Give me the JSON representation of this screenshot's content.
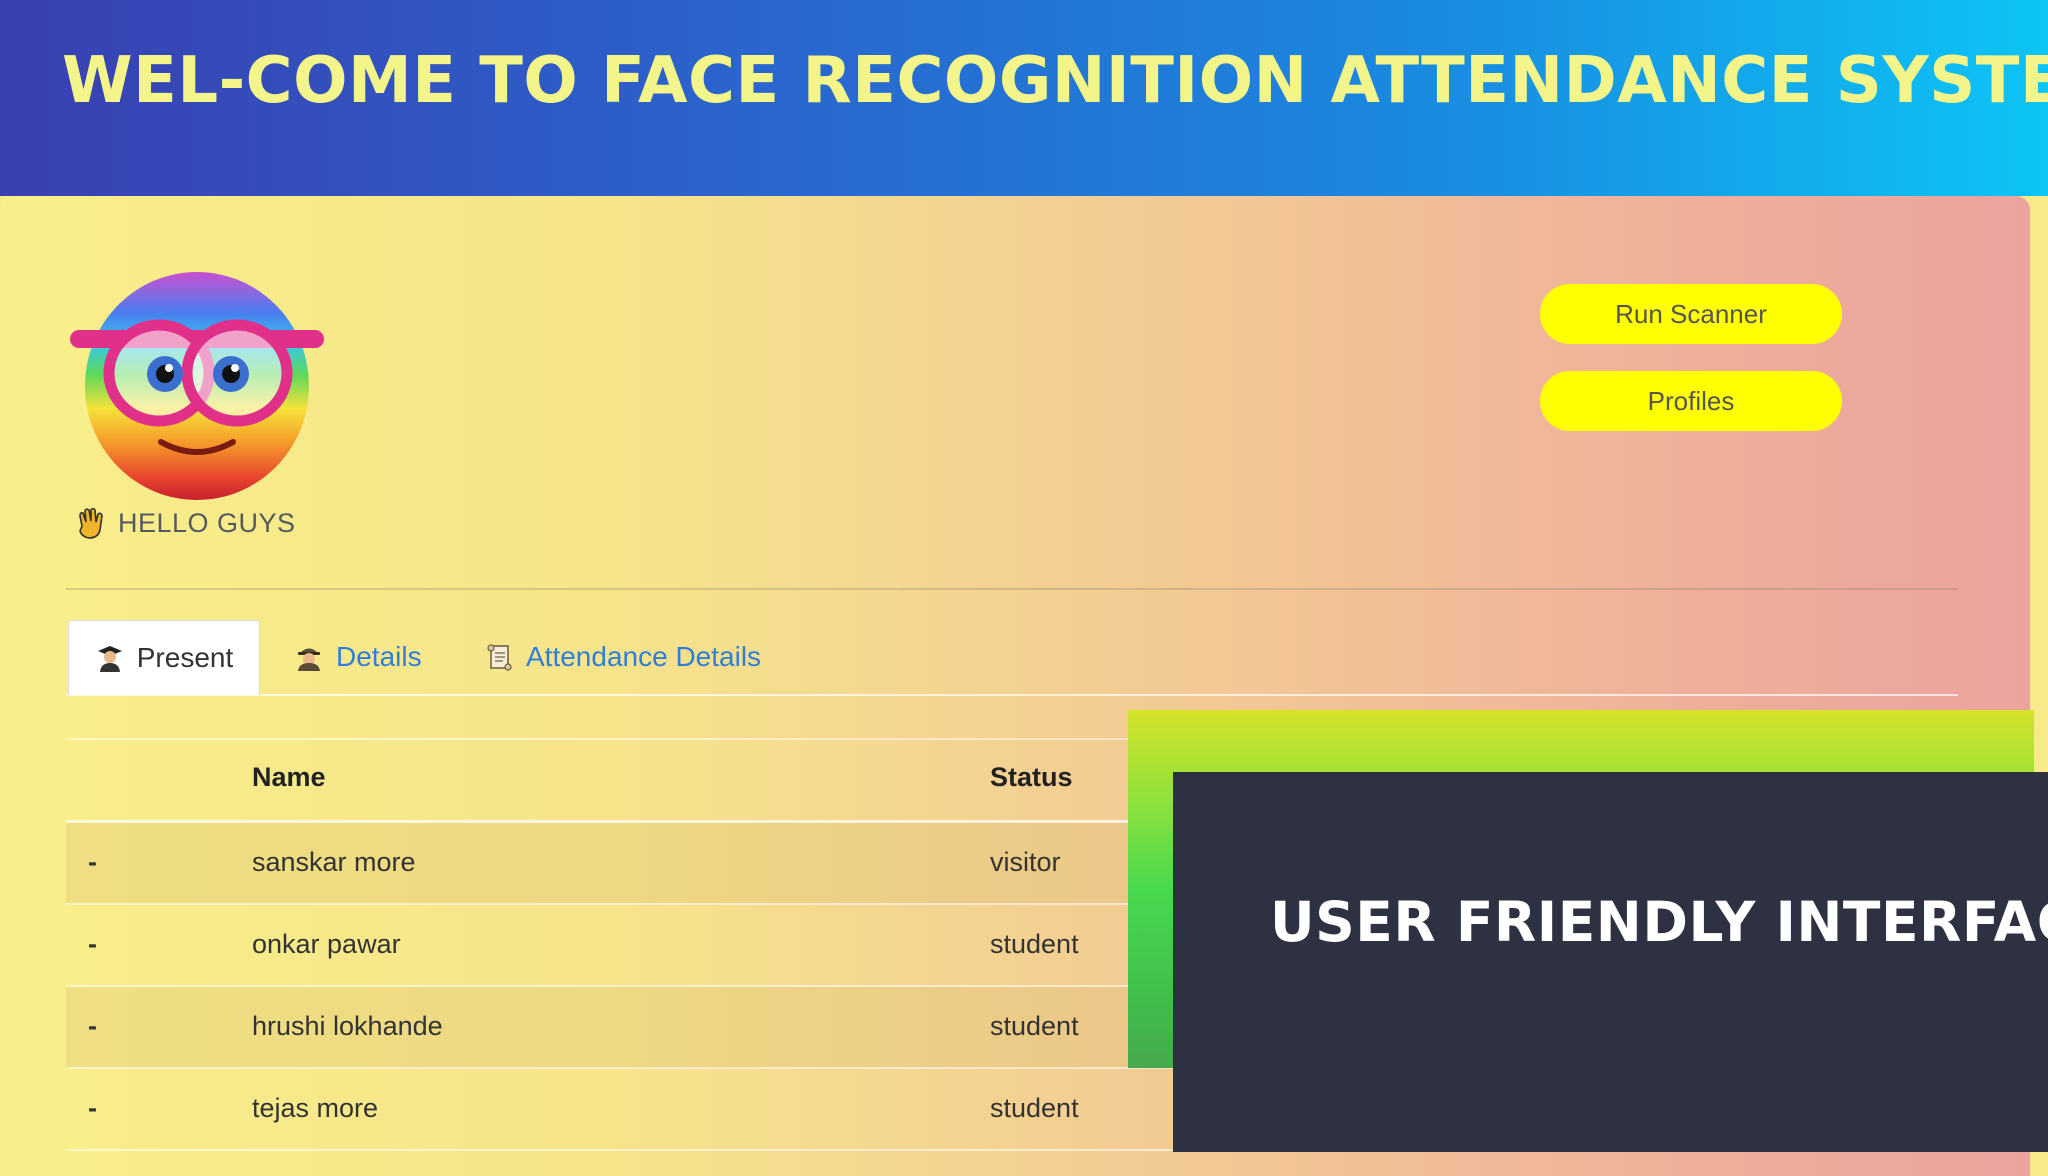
{
  "header": {
    "title": "WEL-COME TO FACE RECOGNITION ATTENDANCE SYSTEM"
  },
  "colors": {
    "header_start": "#3a3fb0",
    "header_end": "#0cc4f6",
    "title": "#f3f58a",
    "button": "#ffff00",
    "link": "#2f7fd8",
    "overlay_dark": "#2e3141"
  },
  "profile": {
    "avatar_icon": "rainbow-emoji-glasses-icon",
    "greeting_icon": "waving-hand-icon",
    "greeting": "HELLO GUYS"
  },
  "actions": {
    "run_scanner": "Run Scanner",
    "profiles": "Profiles"
  },
  "tabs": [
    {
      "label": "Present",
      "icon": "student-icon",
      "active": true
    },
    {
      "label": "Details",
      "icon": "detective-icon",
      "active": false
    },
    {
      "label": "Attendance Details",
      "icon": "scroll-icon",
      "active": false
    }
  ],
  "table": {
    "headers": {
      "name": "Name",
      "status": "Status"
    },
    "rows": [
      {
        "idx": "-",
        "name": "sanskar more",
        "status": "visitor"
      },
      {
        "idx": "-",
        "name": "onkar pawar",
        "status": "student"
      },
      {
        "idx": "-",
        "name": "hrushi lokhande",
        "status": "student"
      },
      {
        "idx": "-",
        "name": "tejas more",
        "status": "student"
      }
    ]
  },
  "overlay": {
    "caption": "USER FRIENDLY INTERFACE"
  }
}
